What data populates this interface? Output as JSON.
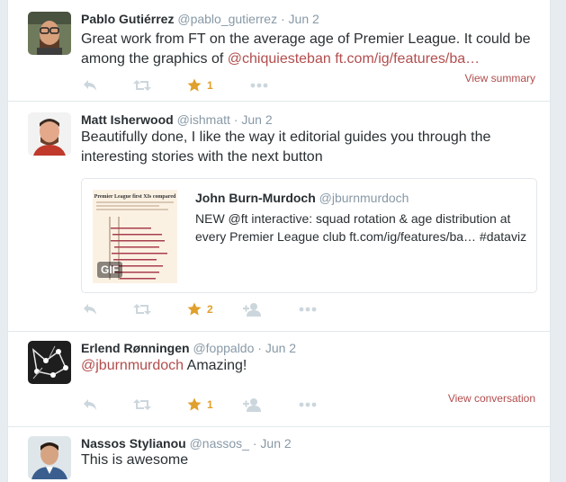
{
  "tweets": [
    {
      "name": "Pablo Gutiérrez",
      "handle": "@pablo_gutierrez",
      "dot": "·",
      "date": "Jun 2",
      "text_before": "Great work from FT on the average age of Premier League. It could be among the graphics of ",
      "mention": "@chiquiesteban",
      "text_between": " ",
      "url": "ft.com/ig/features/ba…",
      "favorite_count": "1",
      "side_link": "View summary"
    },
    {
      "name": "Matt Isherwood",
      "handle": "@ishmatt",
      "dot": "·",
      "date": "Jun 2",
      "text": "Beautifully done, I like the way it editorial guides you through the interesting stories with the next button",
      "favorite_count": "2",
      "card": {
        "name": "John Burn-Murdoch",
        "handle": "@jburnmurdoch",
        "text": "NEW @ft interactive: squad rotation & age distribution at every Premier League club ft.com/ig/features/ba… #dataviz",
        "thumb_title": "Premier League first XIs compared",
        "badge": "GIF"
      }
    },
    {
      "name": "Erlend Rønningen",
      "handle": "@foppaldo",
      "dot": "·",
      "date": "Jun 2",
      "mention": "@jburnmurdoch",
      "text_after": " Amazing!",
      "favorite_count": "1",
      "side_link": "View conversation"
    },
    {
      "name": "Nassos Stylianou",
      "handle": "@nassos_",
      "dot": "·",
      "date": "Jun 2",
      "text": "This is awesome"
    }
  ],
  "icons": {
    "reply": "reply-icon",
    "retweet": "retweet-icon",
    "favorite": "star-icon",
    "follow": "follow-icon",
    "more": "more-icon"
  },
  "colors": {
    "star": "#e0a02b",
    "link": "#b24d4d",
    "icon_gray": "#ccd6dd",
    "name": "#292f33",
    "meta": "#8899a6"
  }
}
